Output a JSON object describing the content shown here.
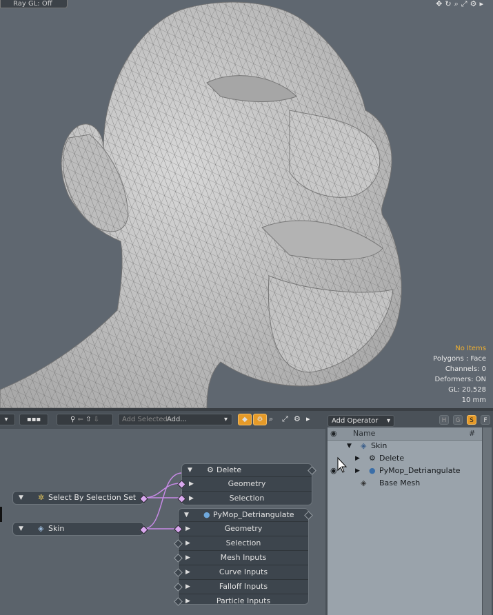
{
  "viewport": {
    "raygl": "Ray GL: Off",
    "tools": [
      "move-icon",
      "rotate-icon",
      "zoom-icon",
      "maximize-icon",
      "gear-icon",
      "arrow-right-icon"
    ],
    "info": {
      "items": "No Items",
      "polygons": "Polygons : Face",
      "channels": "Channels: 0",
      "deformers": "Deformers: ON",
      "gl": "GL: 20,528",
      "unit": "10 mm"
    }
  },
  "schematic": {
    "toolbar": {
      "add_selected": "Add Selected",
      "add_dropdown": "Add..."
    },
    "nodes": {
      "delete": {
        "title": "Delete",
        "inputs": [
          "Geometry",
          "Selection"
        ]
      },
      "select_by_set": {
        "title": "Select By Selection Set"
      },
      "skin": {
        "title": "Skin"
      },
      "pymop": {
        "title": "PyMop_Detriangulate",
        "inputs": [
          "Geometry",
          "Selection",
          "Mesh Inputs",
          "Curve Inputs",
          "Falloff Inputs",
          "Particle Inputs"
        ]
      }
    }
  },
  "panel": {
    "add_operator": "Add Operator",
    "filters": [
      "H",
      "G",
      "S",
      "F"
    ],
    "columns": {
      "name": "Name",
      "hash": "#"
    },
    "tree": [
      {
        "label": "Skin"
      },
      {
        "label": "Delete"
      },
      {
        "label": "PyMop_Detriangulate"
      },
      {
        "label": "Base Mesh"
      }
    ]
  },
  "colors": {
    "accent": "#e59a28",
    "port": "#d9a8ee",
    "link": "#c78ae6"
  }
}
